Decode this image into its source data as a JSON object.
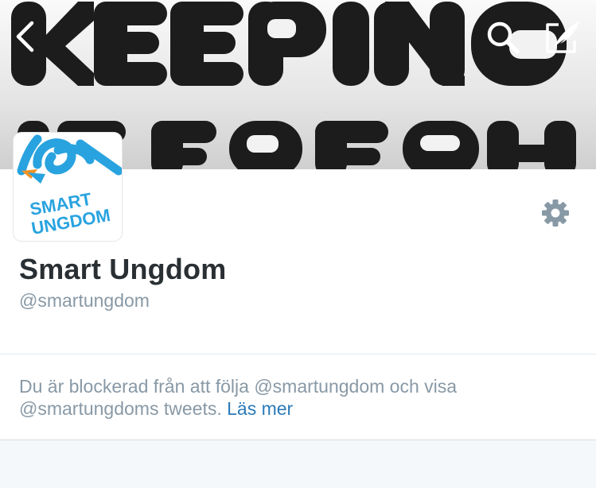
{
  "header": {
    "banner_image": "keeping-it-fresh-banner",
    "banner_text_line1": "KEEPING",
    "banner_text_line2": "IT FRESH",
    "back_icon": "chevron-left-icon",
    "search_icon": "search-icon",
    "compose_icon": "compose-tweet-icon"
  },
  "profile": {
    "avatar_logo_line1": "SMART",
    "avatar_logo_line2": "UNGDOM",
    "display_name": "Smart Ungdom",
    "handle": "@smartungdom",
    "settings_icon": "gear-icon"
  },
  "notice": {
    "text": "Du är blockerad från att följa @smartungdom och visa @smartungdoms tweets.",
    "link_label": "Läs mer"
  },
  "colors": {
    "name": "#292f33",
    "muted": "#8899a6",
    "link": "#2b7bb9",
    "logo_blue": "#29a3df",
    "logo_orange": "#f39322",
    "background": "#f5f8fa"
  }
}
